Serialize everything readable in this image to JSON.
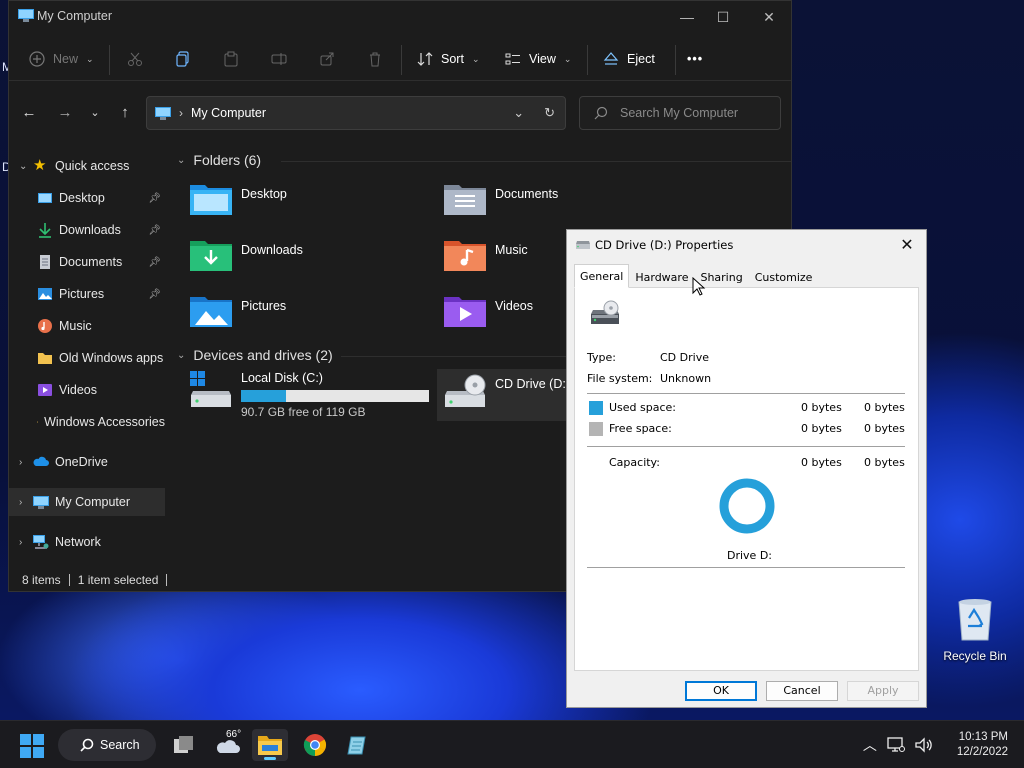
{
  "explorer": {
    "title": "My Computer",
    "toolbar": {
      "new_label": "New",
      "sort_label": "Sort",
      "view_label": "View",
      "eject_label": "Eject",
      "more_label": "•••"
    },
    "address": {
      "path": "My Computer",
      "search_placeholder": "Search My Computer"
    },
    "sidebar": {
      "items": [
        {
          "label": "Quick access",
          "icon": "star-icon"
        },
        {
          "label": "Desktop",
          "icon": "desktop-folder-icon"
        },
        {
          "label": "Downloads",
          "icon": "downloads-icon"
        },
        {
          "label": "Documents",
          "icon": "documents-icon"
        },
        {
          "label": "Pictures",
          "icon": "pictures-icon"
        },
        {
          "label": "Music",
          "icon": "music-icon"
        },
        {
          "label": "Old Windows apps",
          "icon": "folder-icon"
        },
        {
          "label": "Videos",
          "icon": "videos-icon"
        },
        {
          "label": "Windows Accessories",
          "icon": "folder-icon"
        },
        {
          "label": "OneDrive",
          "icon": "cloud-icon"
        },
        {
          "label": "My Computer",
          "icon": "computer-icon"
        },
        {
          "label": "Network",
          "icon": "network-icon"
        }
      ]
    },
    "folders_header": "Folders (6)",
    "folders": [
      {
        "label": "Desktop"
      },
      {
        "label": "Documents"
      },
      {
        "label": "Downloads"
      },
      {
        "label": "Music"
      },
      {
        "label": "Pictures"
      },
      {
        "label": "Videos"
      }
    ],
    "drives_header": "Devices and drives (2)",
    "drives": [
      {
        "name": "Local Disk (C:)",
        "free_text": "90.7 GB free of 119 GB",
        "used_fraction": 0.24
      },
      {
        "name": "CD Drive (D:)"
      }
    ],
    "status": {
      "items": "8 items",
      "selected": "1 item selected"
    }
  },
  "dialog": {
    "title": "CD Drive (D:) Properties",
    "tabs": [
      "General",
      "Hardware",
      "Sharing",
      "Customize"
    ],
    "type_label": "Type:",
    "type_value": "CD Drive",
    "fs_label": "File system:",
    "fs_value": "Unknown",
    "used_label": "Used space:",
    "used_bytes": "0 bytes",
    "used_bytes2": "0 bytes",
    "free_label": "Free space:",
    "free_bytes": "0 bytes",
    "free_bytes2": "0 bytes",
    "capacity_label": "Capacity:",
    "capacity_bytes": "0 bytes",
    "capacity_bytes2": "0 bytes",
    "drive_label": "Drive D:",
    "ok_label": "OK",
    "cancel_label": "Cancel",
    "apply_label": "Apply",
    "used_color": "#26a0da",
    "free_color": "#b4b4b4"
  },
  "desktop": {
    "recycle_bin_label": "Recycle Bin",
    "edge_letters": [
      "M",
      "D"
    ]
  },
  "taskbar": {
    "search_label": "Search",
    "weather_temp": "66°",
    "time": "10:13 PM",
    "date": "12/2/2022"
  }
}
